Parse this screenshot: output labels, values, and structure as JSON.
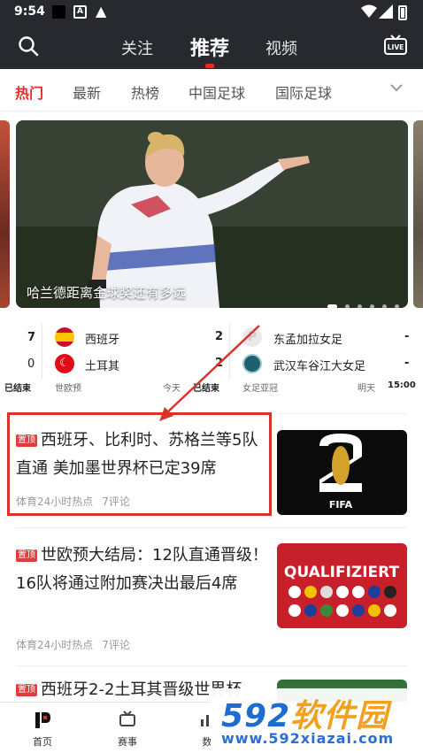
{
  "status_bar": {
    "time": "9:54"
  },
  "top_nav": {
    "tabs": [
      "关注",
      "推荐",
      "视频"
    ],
    "active_tab": "推荐",
    "live_label": "LIVE"
  },
  "categories": [
    "热门",
    "最新",
    "热榜",
    "中国足球",
    "国际足球"
  ],
  "active_category": "热门",
  "banner": {
    "caption": "哈兰德距离金球奖还有多远",
    "dots": 6,
    "active_dot": 0
  },
  "scores": {
    "left_partial": {
      "score1": "7",
      "score2": "0",
      "status": "已结束"
    },
    "match1": {
      "team1": "西班牙",
      "score1": "2",
      "team2": "土耳其",
      "score2": "2",
      "league": "世欧预",
      "date": "今天",
      "status": "已结束"
    },
    "match2": {
      "team1": "东孟加拉女足",
      "score1": "-",
      "team2": "武汉车谷江大女足",
      "score2": "-",
      "league": "女足亚冠",
      "date": "明天",
      "time": "15:00"
    }
  },
  "news": [
    {
      "tag": "置顶",
      "title": "西班牙、比利时、苏格兰等5队直通 美加墨世界杯已定39席",
      "source": "体育24小时热点",
      "comments": "7评论",
      "thumb_text": "FIFA"
    },
    {
      "tag": "置顶",
      "title": "世欧预大结局：12队直通晋级！16队将通过附加赛决出最后4席",
      "source": "体育24小时热点",
      "comments": "7评论",
      "thumb_text": "QUALIFIZIERT"
    },
    {
      "tag": "置顶",
      "title": "西班牙2-2土耳其晋级世界杯",
      "source": "",
      "comments": ""
    }
  ],
  "tab_bar": [
    "首页",
    "赛事",
    "数"
  ],
  "watermark": {
    "brand_num": "592",
    "brand_cn": "软件园",
    "url": "www.592xiazai.com"
  },
  "colors": {
    "accent": "#e62b2b",
    "topbar": "#27292e",
    "highlight": "#d9342b"
  }
}
